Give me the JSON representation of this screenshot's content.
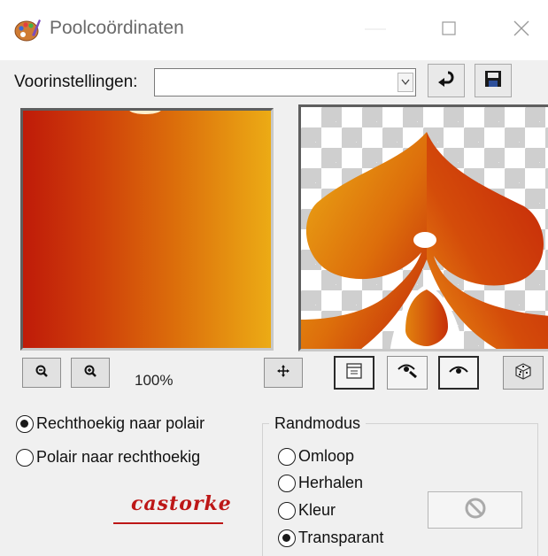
{
  "window": {
    "title": "Poolcoördinaten",
    "icon": "palette-icon",
    "controls": [
      "minimize-icon",
      "maximize-icon",
      "close-icon"
    ]
  },
  "presets": {
    "label": "Voorinstellingen:",
    "value": "",
    "buttons": [
      "reset-arrow-icon",
      "save-disk-icon"
    ]
  },
  "preview": {
    "zoom_level": "100%",
    "left_icons": [
      "zoom-out-icon",
      "zoom-in-icon"
    ],
    "right_icons": [
      "pan-move-icon",
      "proof-toggle-icon",
      "eye-dropper-icon",
      "eye-icon",
      "random-dice-icon"
    ]
  },
  "conversion": {
    "options": [
      {
        "label": "Rechthoekig naar polair",
        "checked": true
      },
      {
        "label": "Polair naar rechthoekig",
        "checked": false
      }
    ]
  },
  "edge_mode": {
    "title": "Randmodus",
    "options": [
      {
        "label": "Omloop",
        "checked": false
      },
      {
        "label": "Herhalen",
        "checked": false
      },
      {
        "label": "Kleur",
        "checked": false
      },
      {
        "label": "Transparant",
        "checked": true
      }
    ],
    "color_swatch_icon": "no-color-icon"
  },
  "logo": {
    "text": "castorke"
  },
  "colors": {
    "gradient_red": "#bf1b09",
    "gradient_orange": "#dc6f0b",
    "gradient_yellow": "#ecab15",
    "logo_red": "#bd1717",
    "checker_gray": "#cfcfcf"
  }
}
